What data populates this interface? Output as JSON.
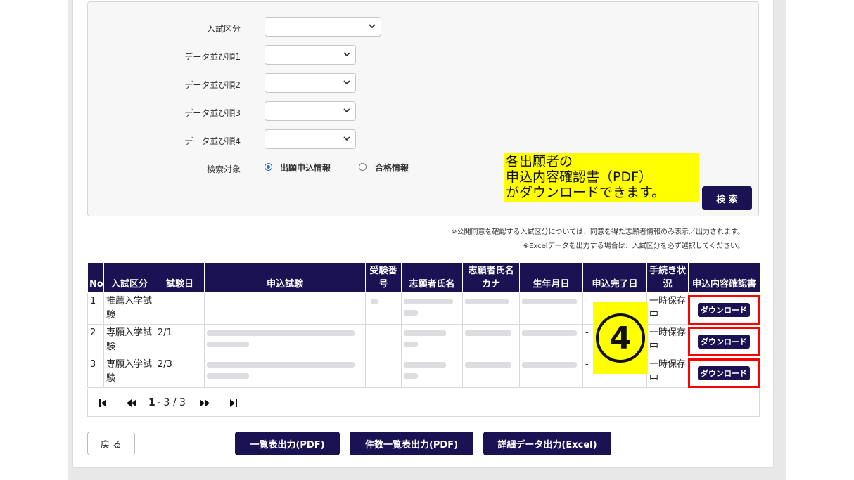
{
  "form": {
    "exam_category_label": "入試区分",
    "sort1_label": "データ並び順1",
    "sort2_label": "データ並び順2",
    "sort3_label": "データ並び順3",
    "sort4_label": "データ並び順4",
    "search_target_label": "検索対象",
    "radio_application": "出願申込情報",
    "radio_pass": "合格情報",
    "search_button": "検 索"
  },
  "annotation": {
    "line1": "各出願者の",
    "line2": "申込内容確認書（PDF）",
    "line3": "がダウンロードできます。",
    "marker": "④"
  },
  "hints": {
    "line1": "※公開同意を確認する入試区分については、同意を得た志願者情報のみ表示／出力されます。",
    "line2": "※Excelデータを出力する場合は、入試区分を必ず選択してください。"
  },
  "table": {
    "headers": [
      "No",
      "入試区分",
      "試験日",
      "申込試験",
      "受験番号",
      "志願者氏名",
      "志願者氏名カナ",
      "生年月日",
      "申込完了日",
      "手続き状況",
      "申込内容確認書"
    ],
    "rows": [
      {
        "no": "1",
        "category": "推薦入学試験",
        "date": "",
        "complete": "-",
        "status": "一時保存中",
        "download": "ダウンロード"
      },
      {
        "no": "2",
        "category": "専願入学試験",
        "date": "2/1",
        "complete": "-",
        "status": "一時保存中",
        "download": "ダウンロード"
      },
      {
        "no": "3",
        "category": "専願入学試験",
        "date": "2/3",
        "complete": "-",
        "status": "一時保存中",
        "download": "ダウンロード"
      }
    ]
  },
  "pagination": {
    "current": "1",
    "range": "- 3 / 3"
  },
  "footer": {
    "back": "戻 る",
    "list_pdf": "一覧表出力(PDF)",
    "count_pdf": "件数一覧表出力(PDF)",
    "detail_excel": "詳細データ出力(Excel)"
  },
  "colors": {
    "navy": "#1a1252",
    "highlight": "#ffff00",
    "annotation_border": "#ff0000"
  }
}
